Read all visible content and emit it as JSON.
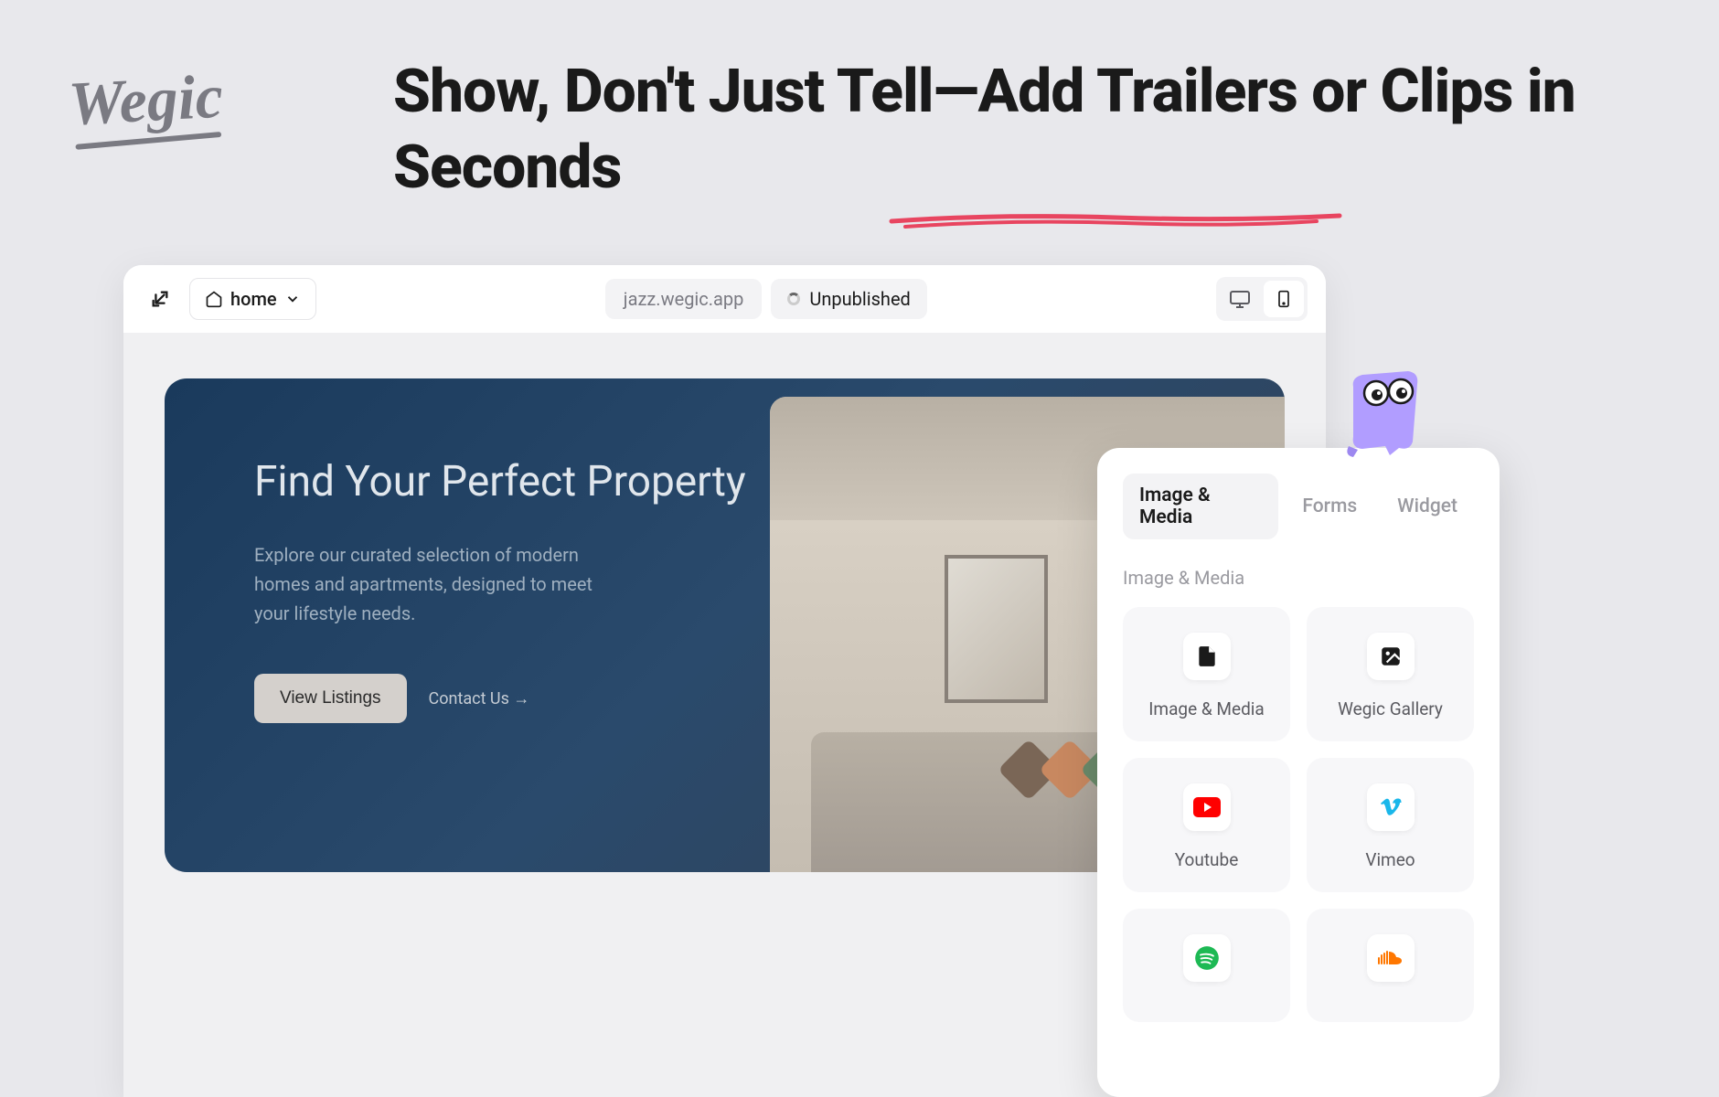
{
  "logo": "Wegic",
  "headline": "Show, Don't Just Tell—Add Trailers or Clips in Seconds",
  "toolbar": {
    "home_label": "home",
    "url": "jazz.wegic.app",
    "status": "Unpublished"
  },
  "hero": {
    "title": "Find Your Perfect Property",
    "description": "Explore our curated selection of modern homes and apartments, designed to meet your lifestyle needs.",
    "primary_cta": "View Listings",
    "secondary_cta": "Contact Us →"
  },
  "panel": {
    "tabs": [
      "Image & Media",
      "Forms",
      "Widget"
    ],
    "active_tab": 0,
    "section_title": "Image & Media",
    "items": [
      {
        "label": "Image & Media",
        "icon": "file"
      },
      {
        "label": "Wegic Gallery",
        "icon": "gallery"
      },
      {
        "label": "Youtube",
        "icon": "youtube"
      },
      {
        "label": "Vimeo",
        "icon": "vimeo"
      },
      {
        "label": "",
        "icon": "spotify"
      },
      {
        "label": "",
        "icon": "soundcloud"
      }
    ]
  },
  "colors": {
    "accent_red": "#e84560",
    "youtube": "#ff0000",
    "vimeo": "#1ab7ea",
    "spotify": "#1db954",
    "soundcloud": "#ff7700"
  }
}
